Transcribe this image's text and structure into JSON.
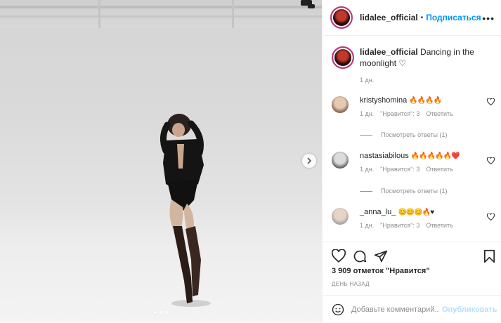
{
  "post": {
    "username": "lidalee_official",
    "follow_label": "Подписаться",
    "more_label": "•••",
    "caption": {
      "username": "lidalee_official",
      "text": "Dancing in the moonlight ♡",
      "time": "1 дн."
    },
    "comments": [
      {
        "username": "kristyshomina",
        "text": "🔥🔥🔥🔥",
        "time": "1 дн.",
        "likes": "\"Нравится\": 3",
        "reply": "Ответить",
        "view_replies": "Посмотреть ответы (1)"
      },
      {
        "username": "nastasiabilous",
        "text": "🔥🔥🔥🔥🔥❤️",
        "time": "1 дн.",
        "likes": "\"Нравится\": 3",
        "reply": "Ответить",
        "view_replies": "Посмотреть ответы (1)"
      },
      {
        "username": "_anna_lu_",
        "text": "😊😊😊🔥♥",
        "time": "1 дн.",
        "likes": "\"Нравится\": 3",
        "reply": "Ответить"
      }
    ],
    "likes_text": "3 909 отметок \"Нравится\"",
    "date_text": "ДЕНЬ НАЗАД",
    "add_comment_placeholder": "Добавьте комментарий...",
    "publish_label": "Опубликовать"
  },
  "icons": {
    "heart": "heart-icon",
    "comment": "comment-icon",
    "share": "send-icon",
    "save": "bookmark-icon",
    "emoji": "smiley-icon",
    "next": "chevron-right-icon"
  },
  "colors": {
    "link": "#0095f6",
    "muted": "#8e8e8e",
    "text": "#262626",
    "publish_disabled": "#b2dffc"
  }
}
